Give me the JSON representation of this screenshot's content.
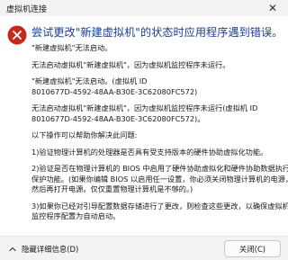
{
  "window": {
    "title": "虚拟机连接",
    "close_glyph": "✕"
  },
  "dialog": {
    "icon": "error-circle-icon",
    "heading": "尝试更改\"新建虚拟机\"的状态时应用程序遇到错误。",
    "paragraphs": [
      "\"新建虚拟机\"无法启动。",
      "无法启动虚拟机\"新建虚拟机\"，因为虚拟机监控程序未运行。",
      "\"新建虚拟机\"无法启动。(虚拟机 ID\n8010677D-4592-48AA-B30E-3C62080FC572)",
      "无法启动虚拟机\"新建虚拟机\"，因为虚拟机监控程序未运行(虚拟机 ID\n8010677D-4592-48AA-B30E-3C62080FC572)。",
      "以下操作可以帮助你解决此问题:",
      "1)验证物理计算机的处理器是否具有受支持版本的硬件协助虚拟化功能。",
      "2)验证是否在物理计算机的 BIOS 中启用了硬件协助虚拟化和硬件协助数据执行\n保护功能。(如果你编辑 BIOS 以启用任一设置，你必须关闭物理计算机的电源，\n然后再打开电源。仅仅重置物理计算机是不够的。)",
      "3)如果你已经对引导配置数据存储进行了更改，则检查这些更改，以确保虚拟机\n监控程序配置为自动启动。"
    ]
  },
  "footer": {
    "details_label": "隐藏详细信息(D)",
    "close_button_label": "关闭(C)"
  },
  "colors": {
    "heading": "#1c3f8f",
    "error": "#c42b1c"
  }
}
